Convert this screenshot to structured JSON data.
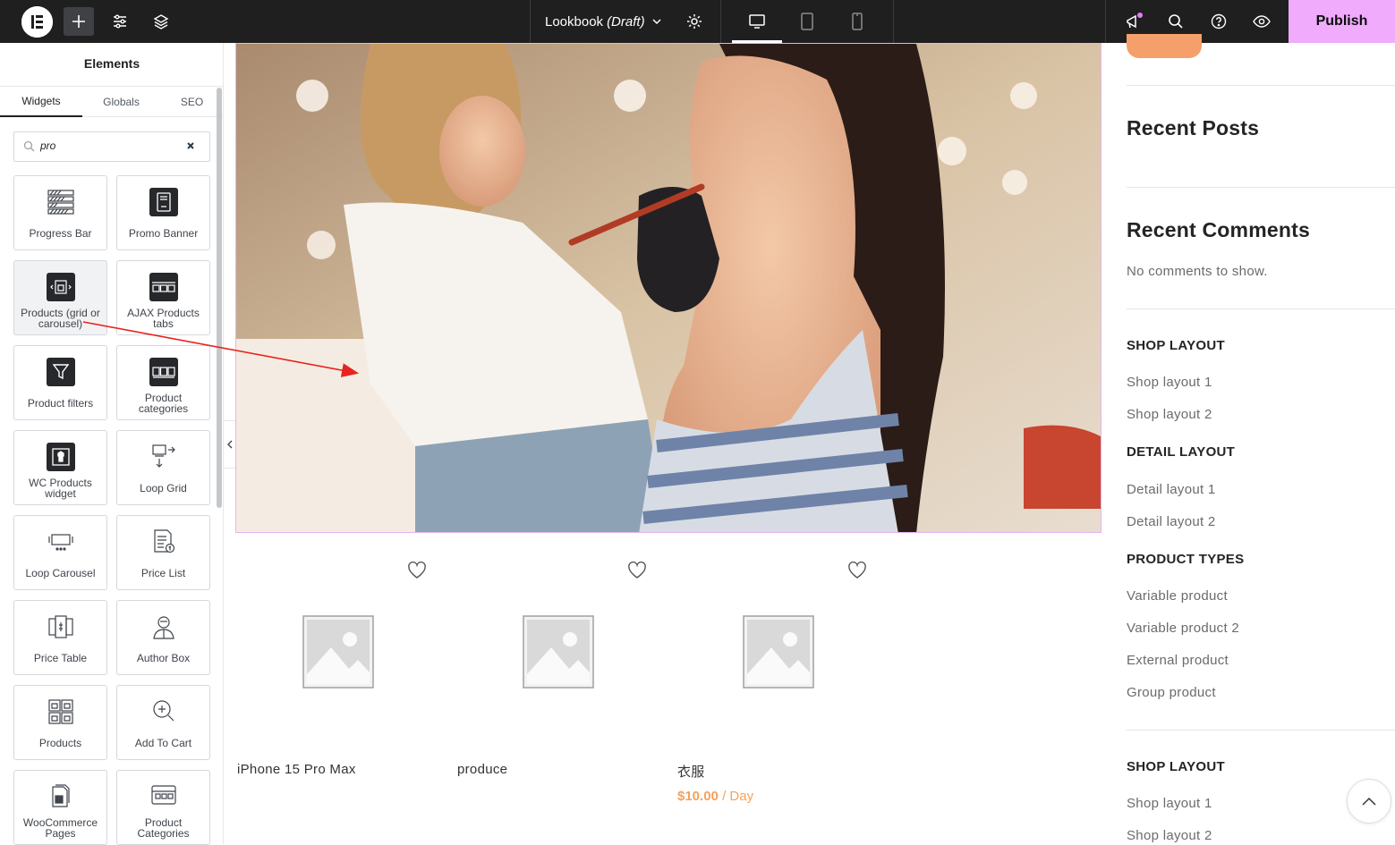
{
  "topbar": {
    "doc_title": "Lookbook",
    "doc_status": "(Draft)",
    "publish_label": "Publish"
  },
  "sidebar": {
    "title": "Elements",
    "tabs": [
      "Widgets",
      "Globals",
      "SEO"
    ],
    "search_value": "pro",
    "widgets": [
      {
        "label": "Progress Bar",
        "icon": "progress-bar-icon"
      },
      {
        "label": "Promo Banner",
        "icon": "promo-banner-icon"
      },
      {
        "label": "Products (grid or carousel)",
        "icon": "products-carousel-icon"
      },
      {
        "label": "AJAX Products tabs",
        "icon": "ajax-products-tabs-icon"
      },
      {
        "label": "Product filters",
        "icon": "filter-icon"
      },
      {
        "label": "Product categories",
        "icon": "product-categories-icon"
      },
      {
        "label": "WC Products widget",
        "icon": "wc-products-widget-icon"
      },
      {
        "label": "Loop Grid",
        "icon": "loop-grid-icon"
      },
      {
        "label": "Loop Carousel",
        "icon": "loop-carousel-icon"
      },
      {
        "label": "Price List",
        "icon": "price-list-icon"
      },
      {
        "label": "Price Table",
        "icon": "price-table-icon"
      },
      {
        "label": "Author Box",
        "icon": "author-box-icon"
      },
      {
        "label": "Products",
        "icon": "products-icon"
      },
      {
        "label": "Add To Cart",
        "icon": "add-to-cart-icon"
      },
      {
        "label": "WooCommerce Pages",
        "icon": "woocommerce-pages-icon"
      },
      {
        "label": "Product Categories",
        "icon": "product-categories-alt-icon"
      }
    ]
  },
  "canvas": {
    "products": [
      {
        "name": "iPhone 15 Pro Max",
        "price": "",
        "unit": ""
      },
      {
        "name": "produce",
        "price": "",
        "unit": ""
      },
      {
        "name": "衣服",
        "price": "$10.00",
        "unit": "/ Day"
      }
    ]
  },
  "right_sidebar": {
    "recent_posts": "Recent Posts",
    "recent_comments": "Recent Comments",
    "no_comments": "No comments to show.",
    "groups": [
      {
        "title": "SHOP LAYOUT",
        "links": [
          "Shop layout 1",
          "Shop layout 2"
        ]
      },
      {
        "title": "DETAIL LAYOUT",
        "links": [
          "Detail layout 1",
          "Detail layout 2"
        ]
      },
      {
        "title": "PRODUCT TYPES",
        "links": [
          "Variable product",
          "Variable product 2",
          "External product",
          "Group product"
        ]
      },
      {
        "title": "SHOP LAYOUT",
        "links": [
          "Shop layout 1",
          "Shop layout 2"
        ]
      }
    ]
  },
  "colors": {
    "topbar": "#1f1f1f",
    "publish": "#f0abfc",
    "price": "#f5a15b",
    "annotation_arrow": "#e8231f"
  }
}
